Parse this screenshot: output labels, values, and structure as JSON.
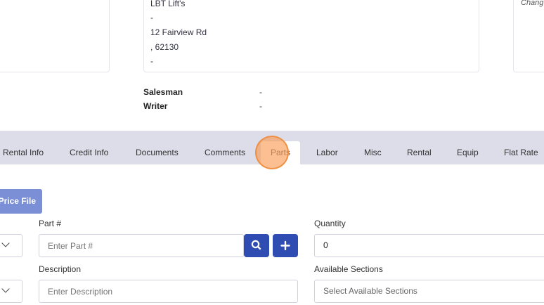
{
  "customer": {
    "name": "LBT Lift's",
    "line2": "-",
    "street": "12 Fairview Rd",
    "city_zip": ", 62130",
    "line5": "-"
  },
  "right_card": {
    "change_label": "Chang"
  },
  "meta": {
    "salesman_label": "Salesman",
    "salesman_value": "-",
    "writer_label": "Writer",
    "writer_value": "-"
  },
  "tabs": [
    {
      "label": "Rental Info"
    },
    {
      "label": "Credit Info"
    },
    {
      "label": "Documents"
    },
    {
      "label": "Comments"
    },
    {
      "label": "Parts",
      "active": true
    },
    {
      "label": "Labor"
    },
    {
      "label": "Misc"
    },
    {
      "label": "Rental"
    },
    {
      "label": "Equip"
    },
    {
      "label": "Flat Rate"
    }
  ],
  "parts_form": {
    "price_file_label": "Price File",
    "part_label": "Part #",
    "part_placeholder": "Enter Part #",
    "quantity_label": "Quantity",
    "quantity_value": "0",
    "description_label": "Description",
    "description_placeholder": "Enter Description",
    "sections_label": "Available Sections",
    "sections_placeholder": "Select Available Sections"
  },
  "colors": {
    "tab_bar": "#dcdde8",
    "primary_button": "#2f4cb3",
    "price_file_button": "#7b8fd6",
    "click_highlight": "#f8984e"
  },
  "icons": {
    "search_button": "search-icon",
    "add_button": "plus-icon",
    "select_toggle": "chevron-down-icon"
  }
}
